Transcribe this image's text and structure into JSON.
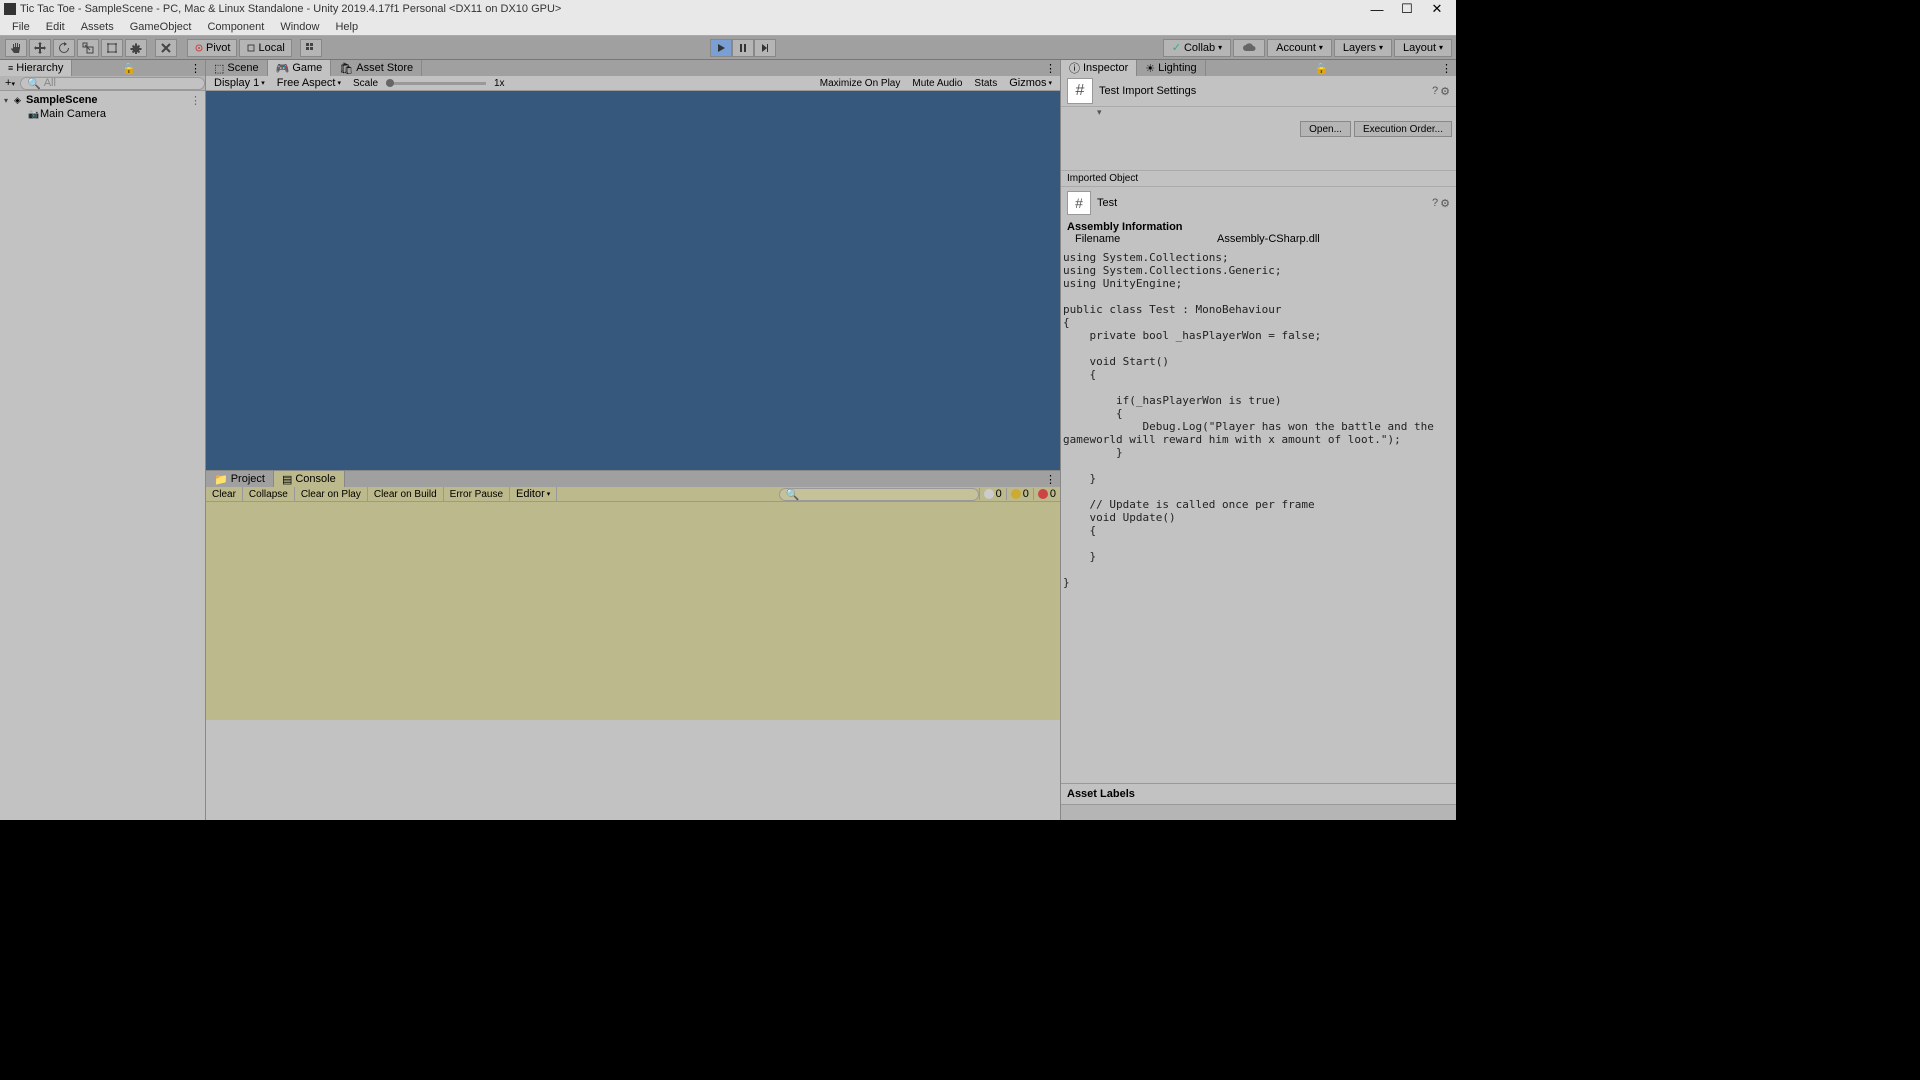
{
  "window": {
    "title": "Tic Tac Toe - SampleScene - PC, Mac & Linux Standalone - Unity 2019.4.17f1 Personal <DX11 on DX10 GPU>"
  },
  "menu": {
    "items": [
      "File",
      "Edit",
      "Assets",
      "GameObject",
      "Component",
      "Window",
      "Help"
    ]
  },
  "toolbar": {
    "pivot": "Pivot",
    "local": "Local",
    "collab": "Collab",
    "account": "Account",
    "layers": "Layers",
    "layout": "Layout"
  },
  "hierarchy": {
    "tab": "Hierarchy",
    "search_placeholder": "All",
    "scene": "SampleScene",
    "items": [
      "Main Camera"
    ]
  },
  "view_tabs": {
    "scene": "Scene",
    "game": "Game",
    "asset_store": "Asset Store"
  },
  "game_toolbar": {
    "display": "Display 1",
    "aspect": "Free Aspect",
    "scale_label": "Scale",
    "scale_value": "1x",
    "maximize": "Maximize On Play",
    "mute": "Mute Audio",
    "stats": "Stats",
    "gizmos": "Gizmos"
  },
  "console": {
    "project_tab": "Project",
    "console_tab": "Console",
    "clear": "Clear",
    "collapse": "Collapse",
    "clear_play": "Clear on Play",
    "clear_build": "Clear on Build",
    "error_pause": "Error Pause",
    "editor": "Editor",
    "info_count": "0",
    "warn_count": "0",
    "err_count": "0"
  },
  "inspector": {
    "tab_inspector": "Inspector",
    "tab_lighting": "Lighting",
    "title": "Test Import Settings",
    "open_btn": "Open...",
    "exec_order_btn": "Execution Order...",
    "imported_object": "Imported Object",
    "object_name": "Test",
    "assembly_info": "Assembly Information",
    "filename_label": "Filename",
    "filename_value": "Assembly-CSharp.dll",
    "code": "using System.Collections;\nusing System.Collections.Generic;\nusing UnityEngine;\n\npublic class Test : MonoBehaviour\n{\n    private bool _hasPlayerWon = false;\n\n    void Start()\n    {\n\n        if(_hasPlayerWon is true)\n        {\n            Debug.Log(\"Player has won the battle and the gameworld will reward him with x amount of loot.\");\n        }\n\n    }\n\n    // Update is called once per frame\n    void Update()\n    {\n\n    }\n\n}",
    "asset_labels": "Asset Labels"
  }
}
